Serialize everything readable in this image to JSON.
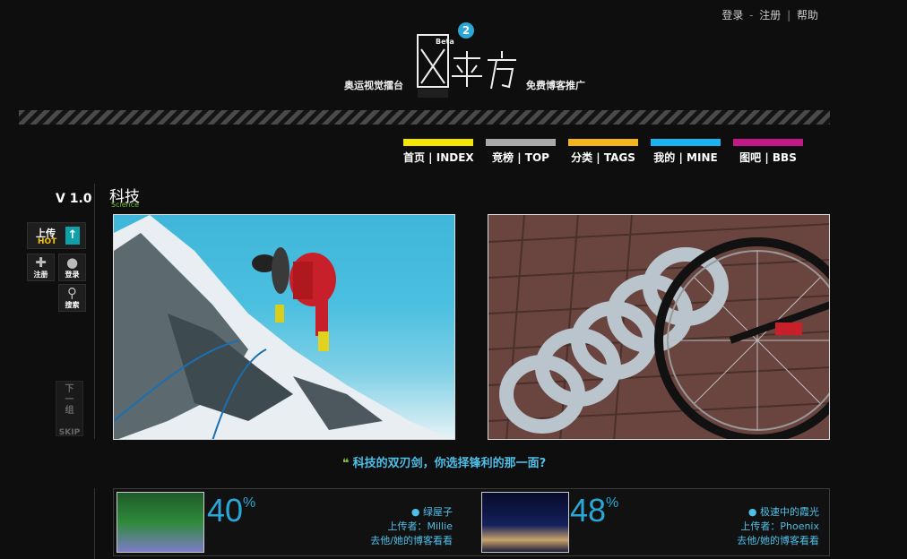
{
  "header": {
    "links": [
      "登录",
      "注册",
      "帮助"
    ],
    "tagline_left": "奥运视觉擂台",
    "tagline_right": "免费博客推广",
    "logo_beta": "Beta",
    "logo_badge": "2"
  },
  "nav": [
    {
      "label": "首页 | INDEX",
      "color": "#f4e600"
    },
    {
      "label": "竞榜 | TOP",
      "color": "#a9a9a9"
    },
    {
      "label": "分类 | TAGS",
      "color": "#f3b51c"
    },
    {
      "label": "我的 | MINE",
      "color": "#1ab4f0"
    },
    {
      "label": "图吧 | BBS",
      "color": "#c21888"
    }
  ],
  "sidebar": {
    "version": "V 1.0",
    "upload_label": "上传",
    "upload_hot": "HOT",
    "register_label": "注册",
    "login_label": "登录",
    "search_label": "搜索",
    "skip_line1": "下",
    "skip_line2": "一",
    "skip_line3": "组",
    "skip_label": "SKIP"
  },
  "category": {
    "title": "科技",
    "subtitle": "Science"
  },
  "question": "科技的双刃剑，你选择锋利的那一面?",
  "results": [
    {
      "percent": "40",
      "title": "绿屋子",
      "uploader_label": "上传者：Millie",
      "blog_link": "去他/她的博客看看"
    },
    {
      "percent": "48",
      "title": "极速中的霞光",
      "uploader_label": "上传者：Phoenix",
      "blog_link": "去他/她的博客看看"
    }
  ]
}
